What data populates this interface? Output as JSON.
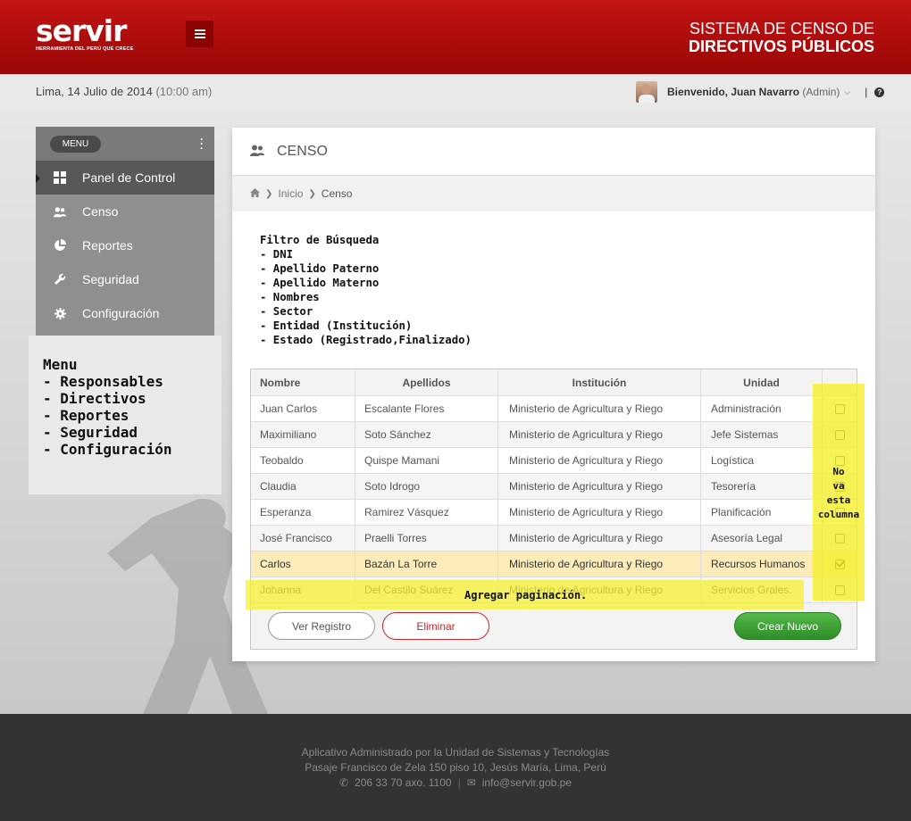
{
  "header": {
    "logo_text": "servir",
    "logo_tagline": "HERRAMIENTA DEL PERÚ QUE CRECE",
    "system_title_line1": "SISTEMA DE CENSO  DE",
    "system_title_line2": "DIRECTIVOS PÚBLICOS",
    "accent_color": "#b50d0d"
  },
  "subheader": {
    "date": "Lima, 14 Julio de 2014",
    "time": "(10:00 am)",
    "welcome": "Bienvenido, Juan Navarro",
    "role": "(Admin)",
    "separator": "|",
    "help_glyph": "?"
  },
  "sidebar": {
    "menu_label": "MENU",
    "items": [
      {
        "label": "Panel de Control",
        "icon": "windows-icon",
        "active": true
      },
      {
        "label": "Censo",
        "icon": "users-icon",
        "active": false
      },
      {
        "label": "Reportes",
        "icon": "pie-chart-icon",
        "active": false
      },
      {
        "label": "Seguridad",
        "icon": "wrench-icon",
        "active": false
      },
      {
        "label": "Configuración",
        "icon": "gear-icon",
        "active": false
      }
    ]
  },
  "notes": {
    "menu_note": "Menu\n- Responsables\n- Directivos\n- Reportes\n- Seguridad\n- Configuración",
    "filter_note": "Filtro de Búsqueda\n- DNI\n- Apellido Paterno\n- Apellido Materno\n- Nombres\n- Sector\n- Entidad (Institución)\n- Estado (Registrado,Finalizado)",
    "column_note": "No\nva\nesta\ncolumna",
    "pagination_note": "Agregar paginación."
  },
  "main": {
    "title": "CENSO",
    "breadcrumb": {
      "home": "Inicio",
      "current": "Censo"
    },
    "table": {
      "headers": [
        "Nombre",
        "Apellidos",
        "Institución",
        "Unidad"
      ],
      "rows": [
        {
          "nombre": "Juan Carlos",
          "apellidos": "Escalante Flores",
          "institucion": "Ministerio de Agricultura y Riego",
          "unidad": "Administración",
          "checked": false
        },
        {
          "nombre": "Maximiliano",
          "apellidos": "Soto Sánchez",
          "institucion": "Ministerio de Agricultura y Riego",
          "unidad": "Jefe Sistemas",
          "checked": false
        },
        {
          "nombre": "Teobaldo",
          "apellidos": "Quispe Mamani",
          "institucion": "Ministerio de Agricultura y Riego",
          "unidad": "Logística",
          "checked": false
        },
        {
          "nombre": "Claudia",
          "apellidos": "Soto Idrogo",
          "institucion": "Ministerio de Agricultura y Riego",
          "unidad": "Tesorería",
          "checked": false
        },
        {
          "nombre": "Esperanza",
          "apellidos": "Ramirez Vásquez",
          "institucion": "Ministerio de Agricultura y Riego",
          "unidad": "Planificación",
          "checked": false
        },
        {
          "nombre": "José Francisco",
          "apellidos": "Praelli Torres",
          "institucion": "Ministerio de Agricultura y Riego",
          "unidad": "Asesoría Legal",
          "checked": false
        },
        {
          "nombre": "Carlos",
          "apellidos": "Bazán La Torre",
          "institucion": "Ministerio de Agricultura y Riego",
          "unidad": "Recursos Humanos",
          "checked": true
        },
        {
          "nombre": "Johanna",
          "apellidos": "Del Castilo Suárez",
          "institucion": "Ministerio de Agricultura y Riego",
          "unidad": "Servicios Grales.",
          "checked": false
        }
      ]
    },
    "buttons": {
      "view": "Ver Registro",
      "delete": "Eliminar",
      "create": "Crear Nuevo"
    }
  },
  "footer": {
    "line1": "Aplicativo Administrado por la Unidad de Sistemas y Tecnologías",
    "line2": "Pasaje Francisco de Zela 150 piso 10, Jesús María, Lima, Perú",
    "phone": "206 33 70 axo. 1100",
    "separator": "|",
    "email": "info@servir.gob.pe"
  }
}
